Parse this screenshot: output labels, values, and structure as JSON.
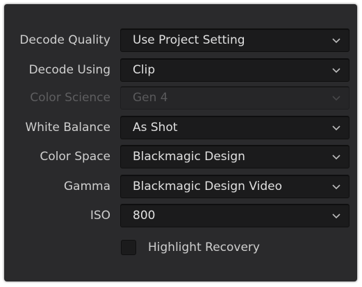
{
  "raw_settings": {
    "rows": [
      {
        "label": "Decode Quality",
        "value": "Use Project Setting",
        "enabled": true
      },
      {
        "label": "Decode Using",
        "value": "Clip",
        "enabled": true
      },
      {
        "label": "Color Science",
        "value": "Gen 4",
        "enabled": false
      },
      {
        "label": "White Balance",
        "value": "As Shot",
        "enabled": true
      },
      {
        "label": "Color Space",
        "value": "Blackmagic Design",
        "enabled": true
      },
      {
        "label": "Gamma",
        "value": "Blackmagic Design Video",
        "enabled": true
      },
      {
        "label": "ISO",
        "value": "800",
        "enabled": true
      }
    ],
    "highlight_recovery": {
      "label": "Highlight Recovery",
      "checked": false
    }
  },
  "icons": {
    "dropdown": "chevron-down-icon"
  },
  "colors": {
    "panel_bg": "#2a2a2c",
    "field_bg": "#1b1b1c",
    "text": "#cfcfcf",
    "disabled_text": "#5e5e60"
  }
}
